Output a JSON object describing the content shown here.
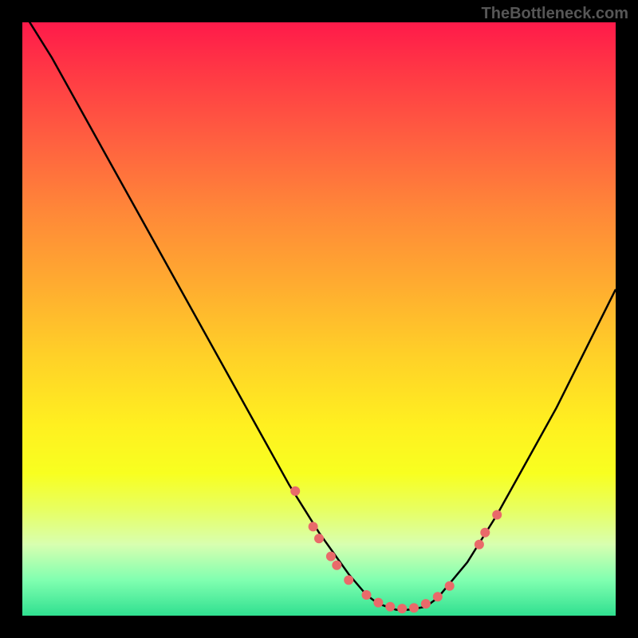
{
  "watermark": "TheBottleneck.com",
  "chart_data": {
    "type": "line",
    "title": "",
    "xlabel": "",
    "ylabel": "",
    "xlim": [
      0,
      100
    ],
    "ylim": [
      0,
      100
    ],
    "series": [
      {
        "name": "curve",
        "x": [
          0,
          5,
          10,
          15,
          20,
          25,
          30,
          35,
          40,
          45,
          50,
          55,
          58,
          60,
          63,
          65,
          68,
          70,
          75,
          80,
          85,
          90,
          95,
          100
        ],
        "y": [
          102,
          94,
          85,
          76,
          67,
          58,
          49,
          40,
          31,
          22,
          14,
          7,
          3.5,
          2,
          1,
          1,
          1.5,
          3,
          9,
          17,
          26,
          35,
          45,
          55
        ]
      }
    ],
    "dots": [
      {
        "x": 46,
        "y": 21
      },
      {
        "x": 49,
        "y": 15
      },
      {
        "x": 50,
        "y": 13
      },
      {
        "x": 52,
        "y": 10
      },
      {
        "x": 53,
        "y": 8.5
      },
      {
        "x": 55,
        "y": 6
      },
      {
        "x": 58,
        "y": 3.5
      },
      {
        "x": 60,
        "y": 2.2
      },
      {
        "x": 62,
        "y": 1.5
      },
      {
        "x": 64,
        "y": 1.2
      },
      {
        "x": 66,
        "y": 1.3
      },
      {
        "x": 68,
        "y": 2
      },
      {
        "x": 70,
        "y": 3.2
      },
      {
        "x": 72,
        "y": 5
      },
      {
        "x": 77,
        "y": 12
      },
      {
        "x": 78,
        "y": 14
      },
      {
        "x": 80,
        "y": 17
      }
    ],
    "colors": {
      "curve": "#000000",
      "dots": "#e96a6a",
      "gradient_top": "#ff1a4a",
      "gradient_bottom": "#30e090"
    }
  }
}
